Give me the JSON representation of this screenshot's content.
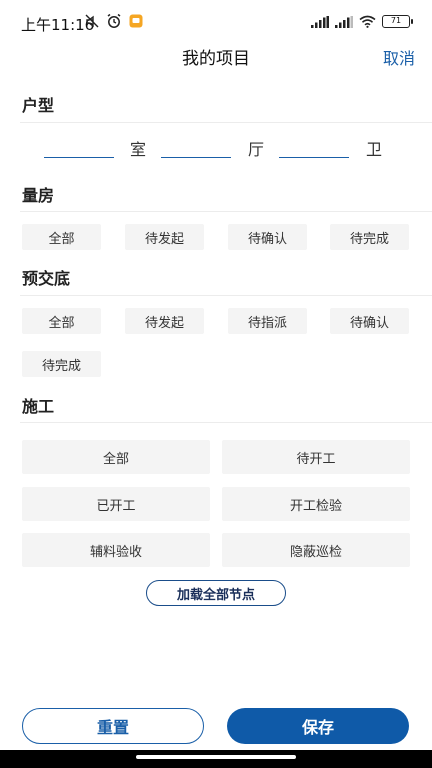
{
  "status_bar": {
    "time": "上午11:16",
    "battery": "71",
    "left_icons": [
      "mute-icon",
      "alarm-icon",
      "notification-icon"
    ],
    "right_icons": [
      "signal-icon",
      "signal-icon",
      "wifi-icon",
      "battery-icon"
    ]
  },
  "nav": {
    "title": "我的项目",
    "cancel": "取消"
  },
  "colors": {
    "accent": "#1a5fa8",
    "chip_bg": "#f4f4f4",
    "save_bg": "#0f5aa8"
  },
  "layout_section": {
    "title": "户型",
    "units": [
      "室",
      "厅",
      "卫"
    ],
    "inputs": [
      "",
      "",
      ""
    ]
  },
  "measure_section": {
    "title": "量房",
    "chips": [
      "全部",
      "待发起",
      "待确认",
      "待完成"
    ]
  },
  "handover_section": {
    "title": "预交底",
    "chips": [
      "全部",
      "待发起",
      "待指派",
      "待确认",
      "待完成"
    ]
  },
  "construction_section": {
    "title": "施工",
    "chips": [
      "全部",
      "待开工",
      "已开工",
      "开工检验",
      "辅料验收",
      "隐蔽巡检"
    ]
  },
  "load_all_label": "加载全部节点",
  "buttons": {
    "reset": "重置",
    "save": "保存"
  }
}
